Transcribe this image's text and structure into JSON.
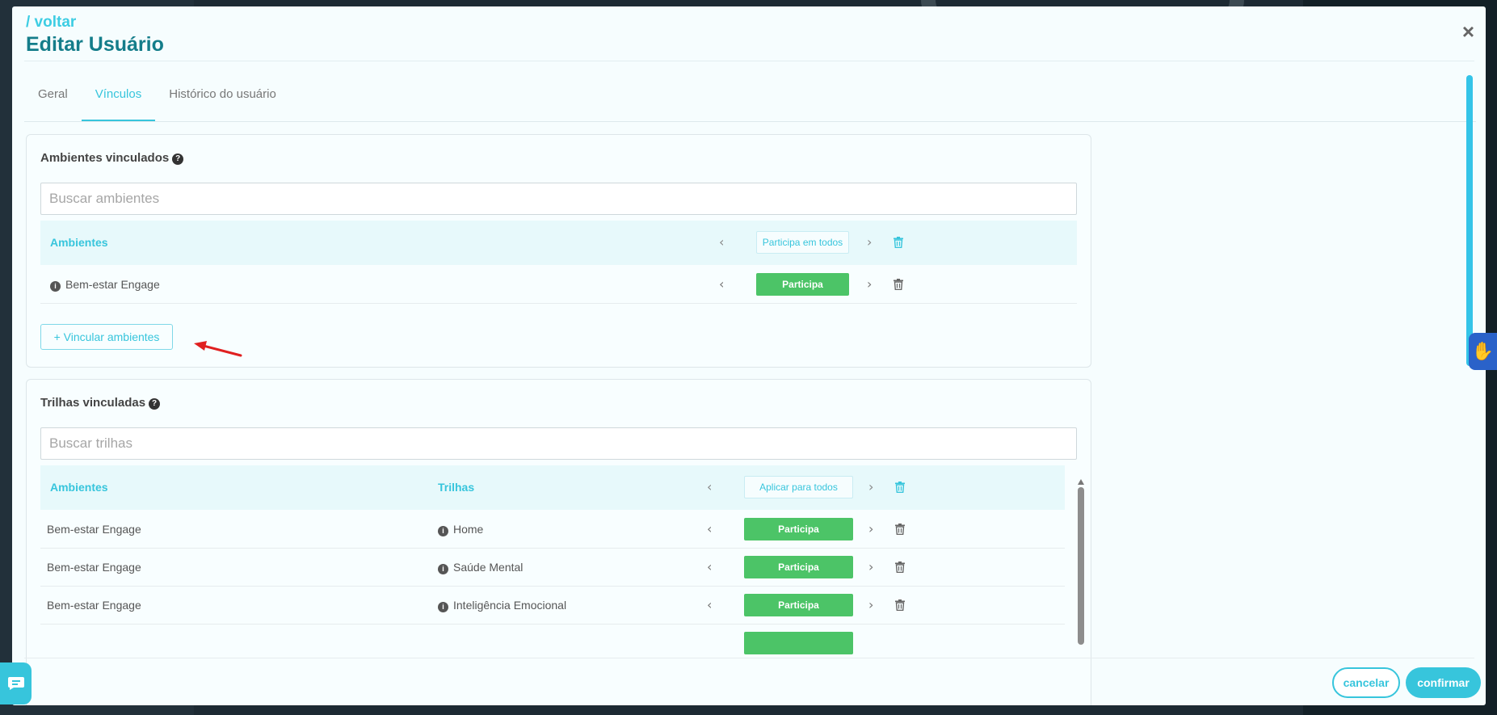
{
  "header": {
    "back_label": "/ voltar",
    "title": "Editar Usuário",
    "close_icon": "×"
  },
  "tabs": [
    {
      "label": "Geral",
      "active": false
    },
    {
      "label": "Vínculos",
      "active": true
    },
    {
      "label": "Histórico do usuário",
      "active": false
    }
  ],
  "ambientes_card": {
    "title": "Ambientes vinculados",
    "help_icon": "?",
    "search_placeholder": "Buscar ambientes",
    "header": {
      "col_ambientes": "Ambientes",
      "bulk_button": "Participa em todos"
    },
    "rows": [
      {
        "name": "Bem-estar Engage",
        "status": "Participa"
      }
    ],
    "add_button": "+ Vincular ambientes"
  },
  "trilhas_card": {
    "title": "Trilhas vinculadas",
    "help_icon": "?",
    "search_placeholder": "Buscar trilhas",
    "header": {
      "col_ambientes": "Ambientes",
      "col_trilhas": "Trilhas",
      "bulk_button": "Aplicar para todos"
    },
    "rows": [
      {
        "ambiente": "Bem-estar Engage",
        "trilha": "Home",
        "status": "Participa"
      },
      {
        "ambiente": "Bem-estar Engage",
        "trilha": "Saúde Mental",
        "status": "Participa"
      },
      {
        "ambiente": "Bem-estar Engage",
        "trilha": "Inteligência Emocional",
        "status": "Participa"
      }
    ]
  },
  "footer": {
    "cancel_label": "cancelar",
    "confirm_label": "confirmar"
  },
  "icons": {
    "chevron_left": "‹",
    "chevron_right": "›",
    "info": "i"
  },
  "colors": {
    "accent": "#37c5dc",
    "title": "#147d8a",
    "success": "#4cc467",
    "annotation_arrow": "#e02020"
  }
}
